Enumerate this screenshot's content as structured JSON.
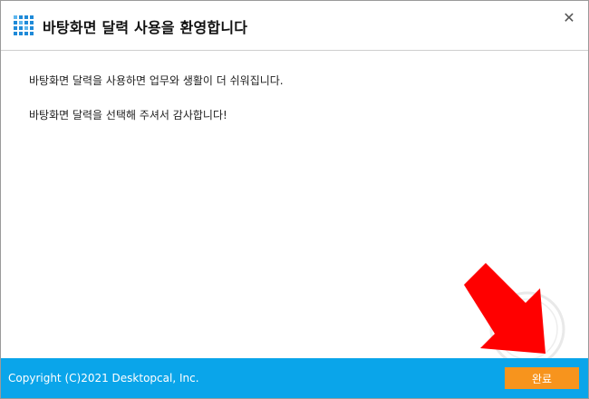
{
  "window": {
    "title": "바탕화면 달력 사용을 환영합니다",
    "close_glyph": "✕"
  },
  "content": {
    "messages": [
      "바탕화면 달력을 사용하면 업무와 생활이 더 쉬워집니다.",
      "바탕화면 달력을 선택해 주셔서 감사합니다!"
    ]
  },
  "footer": {
    "copyright": "Copyright (C)2021 Desktopcal, Inc.",
    "done_label": "완료"
  },
  "colors": {
    "accent": "#0aa5ea",
    "button": "#f7941d",
    "icon": "#1f8ad8",
    "arrow": "#ff0000"
  },
  "icons": {
    "app": "calendar-grid-icon",
    "close": "close-icon",
    "annotation": "red-arrow"
  }
}
